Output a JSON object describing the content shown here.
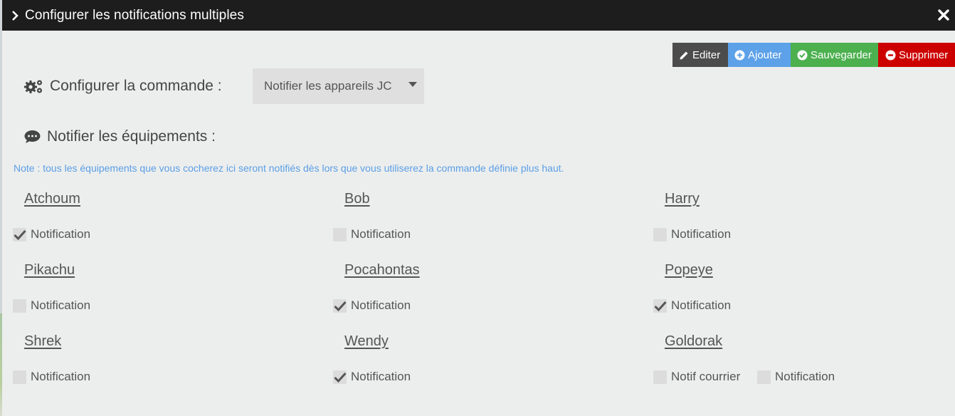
{
  "window": {
    "title": "Configurer les notifications multiples"
  },
  "toolbar": {
    "edit_label": "Editer",
    "add_label": "Ajouter",
    "save_label": "Sauvegarder",
    "delete_label": "Supprimer"
  },
  "command": {
    "label": "Configurer la commande :",
    "selected": "Notifier les appareils JC"
  },
  "notify_section": {
    "label": "Notifier les équipements :",
    "note": "Note : tous les équipements que vous cocherez ici seront notifiés dès lors que vous utiliserez la commande définie plus haut."
  },
  "devices": [
    {
      "name": "Atchoum",
      "checks": [
        {
          "label": "Notification",
          "checked": true
        }
      ]
    },
    {
      "name": "Bob",
      "checks": [
        {
          "label": "Notification",
          "checked": false
        }
      ]
    },
    {
      "name": "Harry",
      "checks": [
        {
          "label": "Notification",
          "checked": false
        }
      ]
    },
    {
      "name": "Pikachu",
      "checks": [
        {
          "label": "Notification",
          "checked": false
        }
      ]
    },
    {
      "name": "Pocahontas",
      "checks": [
        {
          "label": "Notification",
          "checked": true
        }
      ]
    },
    {
      "name": "Popeye",
      "checks": [
        {
          "label": "Notification",
          "checked": true
        }
      ]
    },
    {
      "name": "Shrek",
      "checks": [
        {
          "label": "Notification",
          "checked": false
        }
      ]
    },
    {
      "name": "Wendy",
      "checks": [
        {
          "label": "Notification",
          "checked": true
        }
      ]
    },
    {
      "name": "Goldorak",
      "checks": [
        {
          "label": "Notif courrier",
          "checked": false
        },
        {
          "label": "Notification",
          "checked": false
        }
      ]
    }
  ],
  "colors": {
    "edit": "#4c4c4c",
    "add": "#5da1e8",
    "save": "#4cb04f",
    "delete": "#cc0000",
    "note": "#5b9ee6",
    "titlebar": "#1d1d1d"
  },
  "icons": {
    "title": "chevron-right-icon",
    "close": "close-icon",
    "edit": "pencil-icon",
    "add": "plus-circle-icon",
    "save": "check-circle-icon",
    "delete": "minus-circle-icon",
    "command": "cogs-icon",
    "notify": "comment-icon",
    "checkbox": "checkmark-icon"
  }
}
